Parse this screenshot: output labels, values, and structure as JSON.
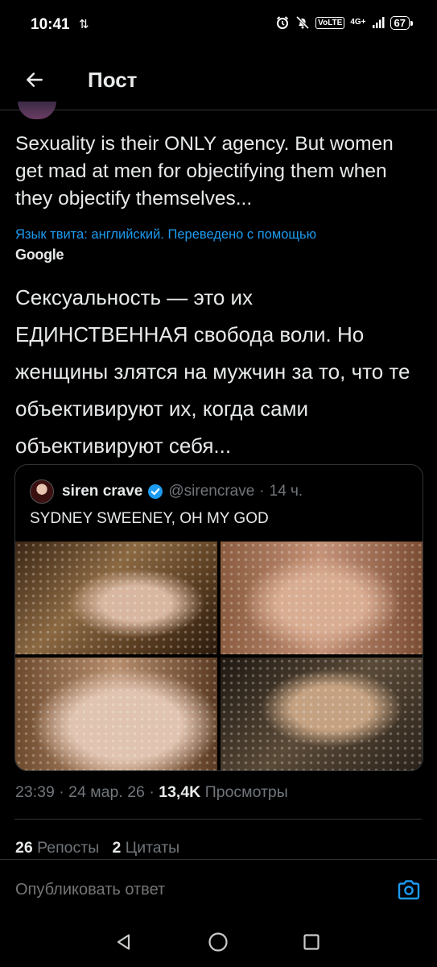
{
  "status_bar": {
    "time": "10:41",
    "indicators": [
      "alarm-icon",
      "mute-icon",
      "VoLTE",
      "4G+",
      "signal-icon"
    ],
    "volte_label": "VoLTE",
    "network_label": "4G+",
    "battery": "67"
  },
  "header": {
    "title": "Пост"
  },
  "tweet": {
    "text": "Sexuality is their ONLY agency. But women get mad at men for objectifying them when they objectify themselves...",
    "translation_note": "Язык твита: английский. Переведено с помощью",
    "translation_provider": "Google",
    "translated_text": "Сексуальность — это их ЕДИНСТВЕННАЯ свобода воли. Но женщины злятся на мужчин за то, что те объективируют их, когда сами объективируют себя..."
  },
  "quote": {
    "name": "siren crave",
    "handle": "@sirencrave",
    "separator": "·",
    "time": "14 ч.",
    "text": "SYDNEY SWEENEY, OH MY GOD",
    "media_count": 4
  },
  "meta": {
    "time": "23:39",
    "date": "24 мар. 26",
    "separator": "·",
    "views_count": "13,4K",
    "views_label": "Просмотры"
  },
  "stats": {
    "reposts_count": "26",
    "reposts_label": "Репосты",
    "quotes_count": "2",
    "quotes_label": "Цитаты"
  },
  "reply": {
    "placeholder": "Опубликовать ответ"
  },
  "colors": {
    "background": "#000000",
    "text": "#e7e9ea",
    "muted": "#71767b",
    "accent": "#1d9bf0",
    "border": "#2f3336"
  }
}
